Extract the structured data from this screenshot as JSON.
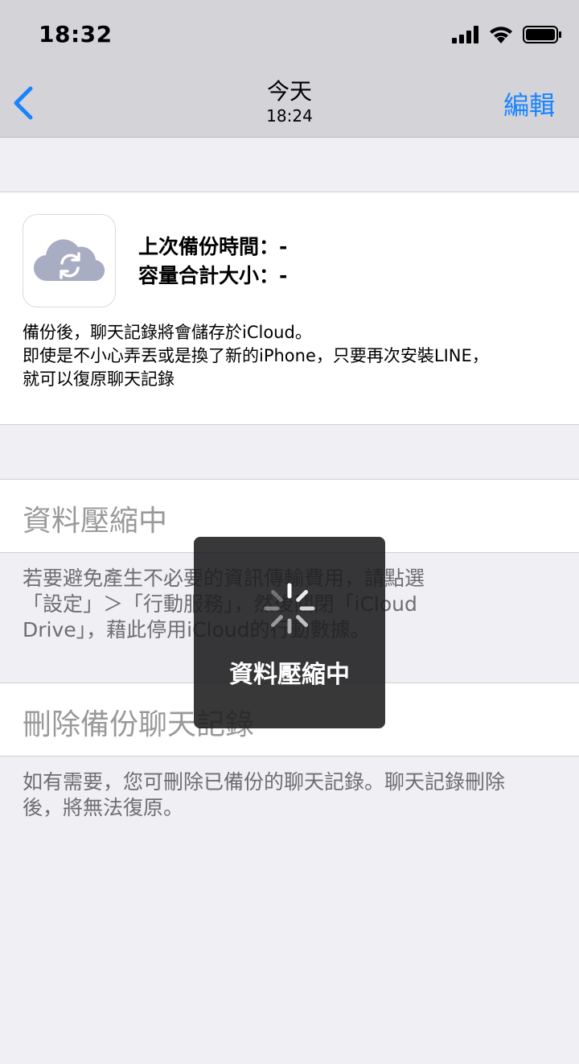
{
  "status": {
    "time": "18:32"
  },
  "nav": {
    "title": "今天",
    "subtitle": "18:24",
    "edit_label": "編輯"
  },
  "backup": {
    "last_backup": "上次備份時間：-",
    "total_size": "容量合計大小：-",
    "desc_line1": "備份後，聊天記錄將會儲存於iCloud。",
    "desc_line2": "即使是不小心弄丟或是換了新的iPhone，只要再次安裝LINE，",
    "desc_line3": "就可以復原聊天記錄"
  },
  "compress": {
    "title": "資料壓縮中",
    "note_line1": "若要避免產生不必要的資訊傳輸費用，請點選",
    "note_line2": "「設定」＞「行動服務」，然後關閉「iCloud",
    "note_line3": "Drive」，藉此停用iCloud的行動數據。"
  },
  "delete": {
    "title": "刪除備份聊天記錄",
    "note_line1": "如有需要，您可刪除已備份的聊天記錄。聊天記錄刪除",
    "note_line2": "後，將無法復原。"
  },
  "hud": {
    "text": "資料壓縮中"
  },
  "colors": {
    "accent": "#1a84ff",
    "cloud": "#a8adc4"
  }
}
